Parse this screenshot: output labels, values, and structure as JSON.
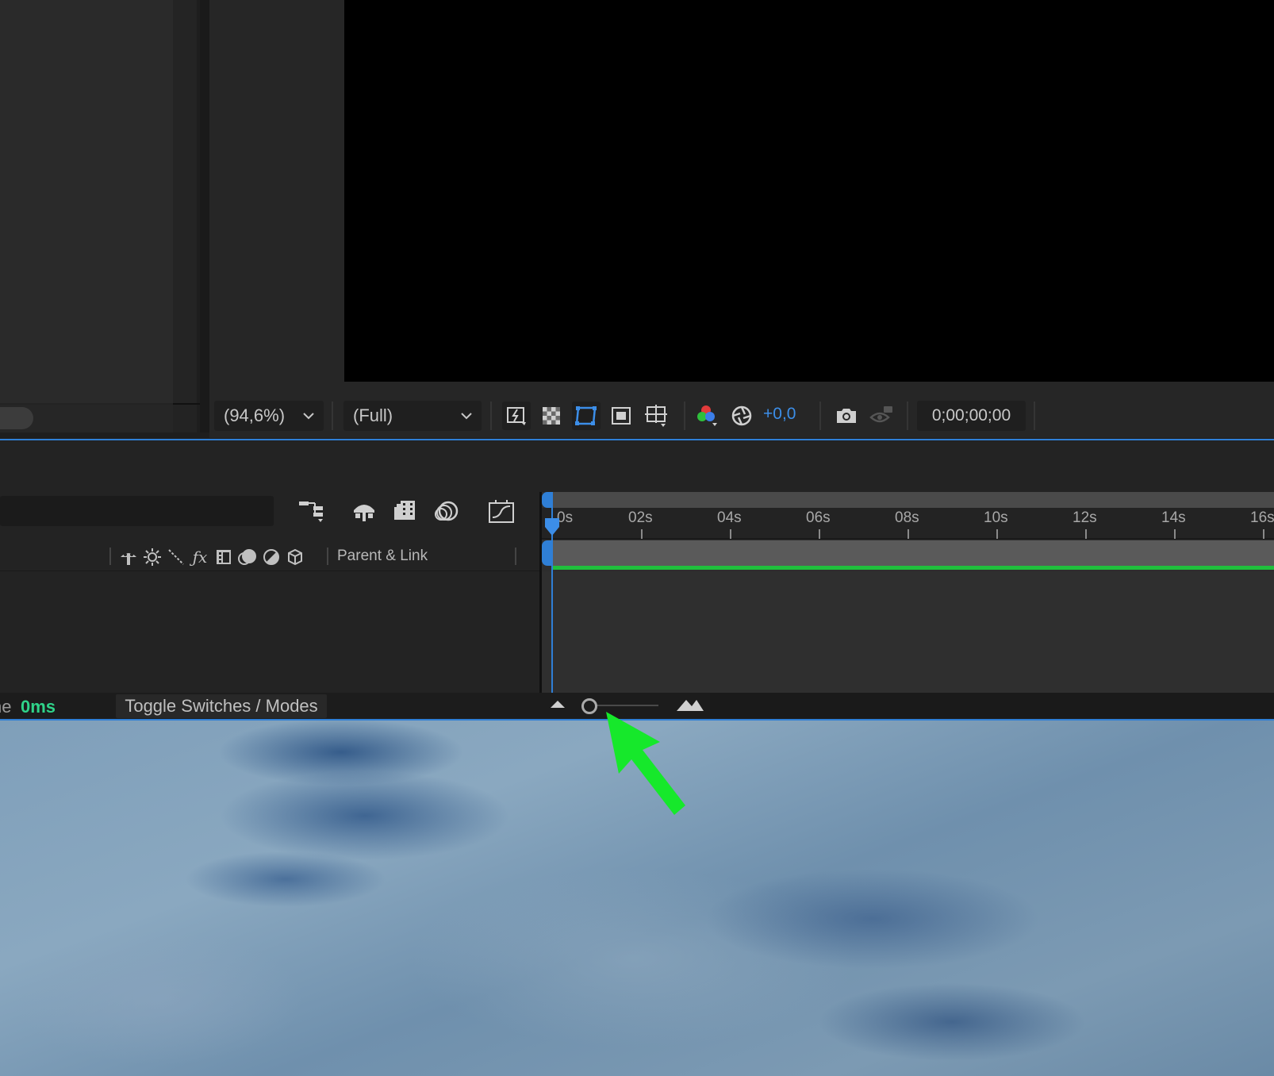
{
  "viewer": {
    "magnification": "(94,6%)",
    "resolution": "(Full)",
    "exposure": "+0,0",
    "timecode": "0;00;00;00"
  },
  "timeline": {
    "header": {
      "parent_link": "Parent & Link"
    },
    "ruler_ticks": [
      "0s",
      "02s",
      "04s",
      "06s",
      "08s",
      "10s",
      "12s",
      "14s",
      "16s"
    ]
  },
  "status_bar": {
    "frame_render_label": "ne",
    "frame_render_value": "0ms",
    "toggle_label": "Toggle Switches / Modes"
  },
  "colors": {
    "accent_blue": "#2f7fd6",
    "render_green": "#1fbf3c",
    "frame_time_green": "#2fd38a",
    "annotation_arrow": "#16e82b"
  },
  "icons": {
    "fast_preview": "fast-previews-icon",
    "transparency_grid": "transparency-grid-icon",
    "mask_path": "mask-path-visibility-icon",
    "region_of_interest": "region-of-interest-icon",
    "guides": "grid-guides-icon",
    "channel": "show-channel-icon",
    "color_management": "color-management-icon",
    "snapshot": "snapshot-camera-icon",
    "show_snapshot": "show-snapshot-icon",
    "zoom_out": "zoom-out-mountain-icon",
    "zoom_in": "zoom-in-mountain-icon"
  }
}
